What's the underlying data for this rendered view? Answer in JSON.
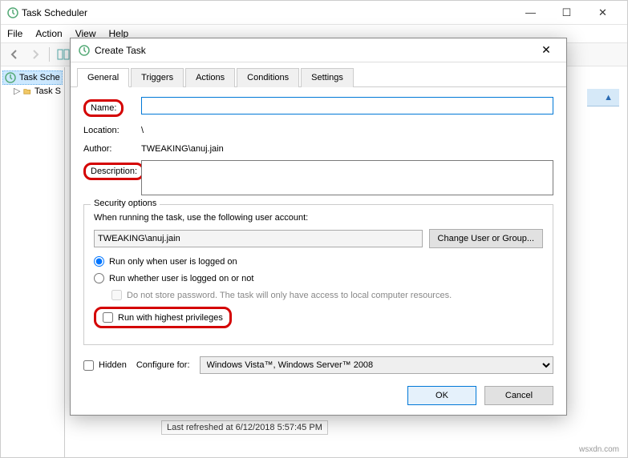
{
  "window": {
    "title": "Task Scheduler",
    "minimize": "—",
    "maximize": "☐",
    "close": "✕"
  },
  "menubar": {
    "file": "File",
    "action": "Action",
    "view": "View",
    "help": "Help"
  },
  "tree": {
    "root": "Task Sche",
    "child": "Task S"
  },
  "status": "Last refreshed at 6/12/2018 5:57:45 PM",
  "attribution": "wsxdn.com",
  "dialog": {
    "title": "Create Task",
    "close": "✕",
    "tabs": {
      "general": "General",
      "triggers": "Triggers",
      "actions": "Actions",
      "conditions": "Conditions",
      "settings": "Settings"
    },
    "fields": {
      "name_label": "Name:",
      "name_value": "",
      "location_label": "Location:",
      "location_value": "\\",
      "author_label": "Author:",
      "author_value": "TWEAKING\\anuj.jain",
      "description_label": "Description:",
      "description_value": ""
    },
    "security": {
      "legend": "Security options",
      "prompt": "When running the task, use the following user account:",
      "user": "TWEAKING\\anuj.jain",
      "change_btn": "Change User or Group...",
      "radio_logged_on": "Run only when user is logged on",
      "radio_whether": "Run whether user is logged on or not",
      "check_nopass": "Do not store password. The task will only have access to local computer resources.",
      "check_highest": "Run with highest privileges"
    },
    "config": {
      "hidden": "Hidden",
      "configure_label": "Configure for:",
      "configure_value": "Windows Vista™, Windows Server™ 2008"
    },
    "buttons": {
      "ok": "OK",
      "cancel": "Cancel"
    }
  }
}
